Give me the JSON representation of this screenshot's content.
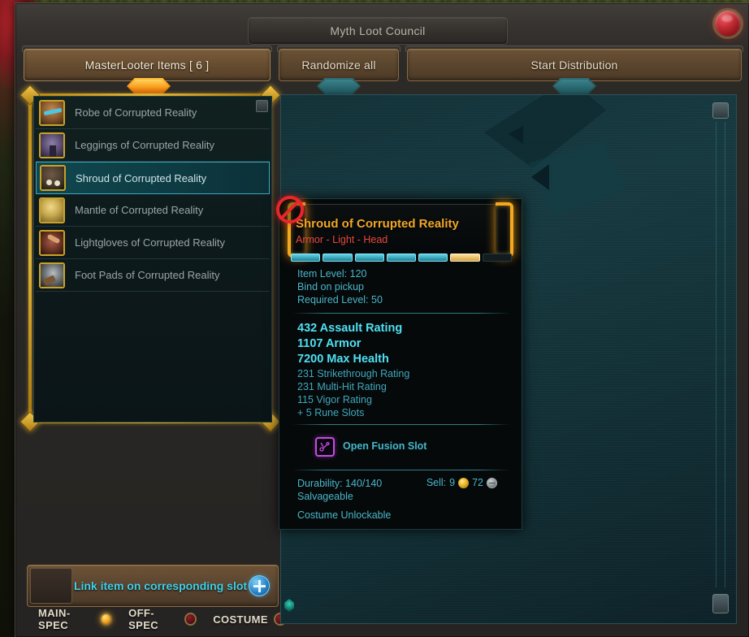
{
  "window": {
    "title": "Myth Loot Council",
    "close_icon": "close-orb-icon"
  },
  "tabs": [
    {
      "label": "MasterLooter Items [ 6 ]",
      "active": true,
      "indicator": "amber"
    },
    {
      "label": "Randomize all",
      "active": false,
      "indicator": "teal"
    },
    {
      "label": "Start Distribution",
      "active": false,
      "indicator": "teal"
    }
  ],
  "item_list": {
    "items": [
      {
        "name": "Robe of Corrupted Reality",
        "icon": "robe-icon",
        "selected": false
      },
      {
        "name": "Leggings of Corrupted Reality",
        "icon": "leggings-icon",
        "selected": false
      },
      {
        "name": "Shroud of Corrupted Reality",
        "icon": "shroud-icon",
        "selected": true
      },
      {
        "name": "Mantle of Corrupted Reality",
        "icon": "mantle-icon",
        "selected": false
      },
      {
        "name": "Lightgloves of Corrupted Reality",
        "icon": "lightgloves-icon",
        "selected": false
      },
      {
        "name": "Foot Pads of Corrupted Reality",
        "icon": "footpads-icon",
        "selected": false
      }
    ]
  },
  "link_bar": {
    "label": "Link item on corresponding slot",
    "plus_icon": "plus-circle-icon"
  },
  "spec_row": [
    {
      "label": "MAIN-SPEC",
      "state": "on"
    },
    {
      "label": "OFF-SPEC",
      "state": "off"
    },
    {
      "label": "COSTUME",
      "state": "off"
    }
  ],
  "tooltip": {
    "no_equip_icon": "prohibited-icon",
    "title": "Shroud of Corrupted Reality",
    "subtitle": "Armor - Light - Head",
    "quality_segments": [
      "full",
      "full",
      "full",
      "full",
      "full",
      "gold",
      "empty"
    ],
    "info": [
      "Item Level: 120",
      "Bind on pickup",
      "Required Level: 50"
    ],
    "stats_major": [
      "432 Assault Rating",
      "1107 Armor",
      "7200 Max Health"
    ],
    "stats_minor": [
      "231 Strikethrough Rating",
      "231 Multi-Hit Rating",
      "115 Vigor Rating",
      "+ 5 Rune Slots"
    ],
    "fusion": {
      "icon": "rune-slot-icon",
      "label": "Open Fusion Slot"
    },
    "footer": {
      "durability": "Durability: 140/140",
      "salvageable": "Salvageable",
      "costume": "Costume Unlockable",
      "sell_label": "Sell:",
      "sell_gold": "9",
      "sell_silver": "72"
    }
  },
  "colors": {
    "title_gold": "#f0a726",
    "subtitle_red": "#e8483c",
    "stat_cyan": "#4fe0f2",
    "link_cyan": "#3fd0e8",
    "frame_gold": "#e0b437",
    "accent_teal": "#2f6d74"
  }
}
